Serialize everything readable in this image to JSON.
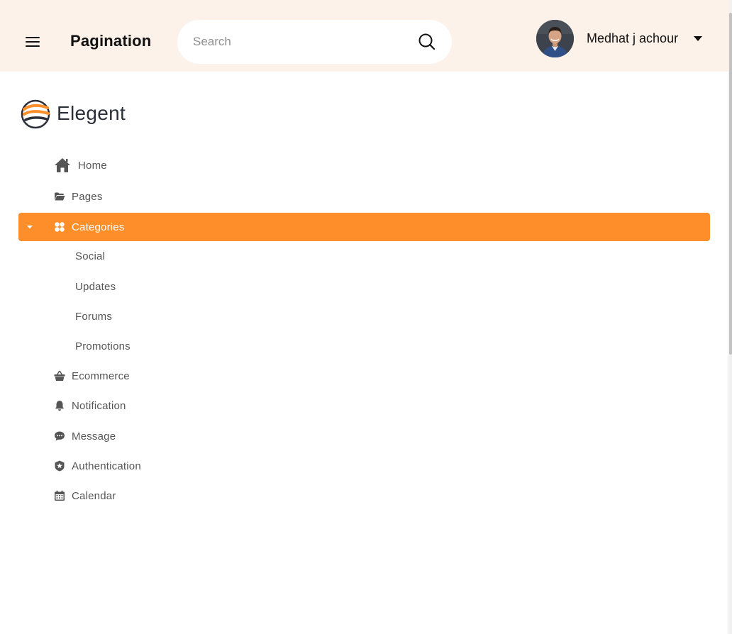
{
  "header": {
    "title": "Pagination",
    "search_placeholder": "Search",
    "user_name": "Medhat j achour"
  },
  "brand": {
    "name": "Elegent",
    "accent_color": "#fe8e2a",
    "header_bg": "#fdf2ea"
  },
  "sidebar": {
    "items": [
      {
        "label": "Home",
        "icon": "home-icon"
      },
      {
        "label": "Pages",
        "icon": "folder-icon"
      },
      {
        "label": "Categories",
        "icon": "grid-icon",
        "active": true,
        "expanded": true
      },
      {
        "label": "Ecommerce",
        "icon": "basket-icon"
      },
      {
        "label": "Notification",
        "icon": "bell-icon"
      },
      {
        "label": "Message",
        "icon": "comment-icon"
      },
      {
        "label": "Authentication",
        "icon": "star-badge-icon"
      },
      {
        "label": "Calendar",
        "icon": "calendar-icon"
      }
    ],
    "sub_items": [
      "Social",
      "Updates",
      "Forums",
      "Promotions"
    ]
  }
}
